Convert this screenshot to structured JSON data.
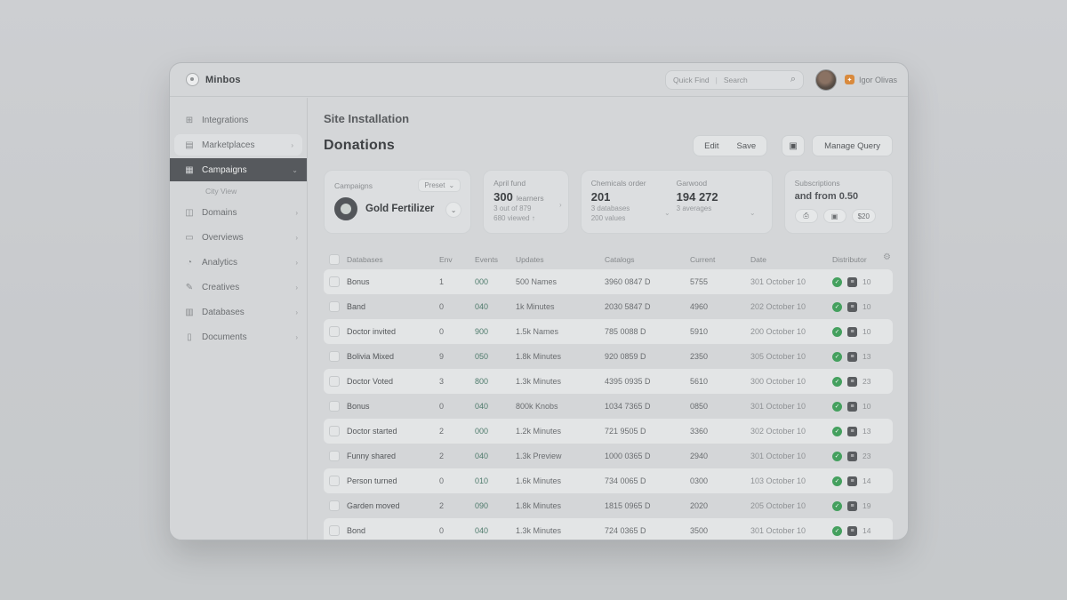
{
  "colors": {
    "accent_green": "#44a05e",
    "teal": "#4f7b6c",
    "orange": "#d98a3d",
    "selected_dark": "#56595d"
  },
  "window": {
    "brand": "Minbos"
  },
  "topbar": {
    "search": {
      "shortcut": "Quick Find",
      "divider": "|",
      "placeholder": "Search",
      "icon": "⌕"
    },
    "user": {
      "name": "Igor Olivas",
      "badge": "✦"
    }
  },
  "sidebar": {
    "items": [
      {
        "label": "Integrations",
        "icon_glyph": "⊞",
        "icon_name": "integrations-icon",
        "chevron": "",
        "variant": "default"
      },
      {
        "label": "Marketplaces",
        "icon_glyph": "▤",
        "icon_name": "marketplaces-icon",
        "chevron": "›",
        "variant": "pill"
      },
      {
        "label": "Campaigns",
        "icon_glyph": "▦",
        "icon_name": "campaigns-icon",
        "chevron": "⌄",
        "variant": "selected"
      },
      {
        "label": "City View",
        "icon_glyph": "",
        "icon_name": "",
        "chevron": "",
        "variant": "sub"
      },
      {
        "label": "Domains",
        "icon_glyph": "◫",
        "icon_name": "domains-icon",
        "chevron": "›",
        "variant": "default"
      },
      {
        "label": "Overviews",
        "icon_glyph": "▭",
        "icon_name": "overviews-icon",
        "chevron": "›",
        "variant": "default"
      },
      {
        "label": "Analytics",
        "icon_glyph": "◔",
        "icon_name": "analytics-icon",
        "chevron": "›",
        "variant": "default"
      },
      {
        "label": "Creatives",
        "icon_glyph": "✎",
        "icon_name": "creatives-icon",
        "chevron": "›",
        "variant": "default"
      },
      {
        "label": "Databases",
        "icon_glyph": "▥",
        "icon_name": "databases-icon",
        "chevron": "›",
        "variant": "default"
      },
      {
        "label": "Documents",
        "icon_glyph": "▯",
        "icon_name": "documents-icon",
        "chevron": "›",
        "variant": "default"
      }
    ]
  },
  "page": {
    "breadcrumb": "Site Installation",
    "title": "Donations"
  },
  "actions": {
    "edit": "Edit",
    "save": "Save",
    "tool_icon": "▣",
    "manage": "Manage Query"
  },
  "cards": {
    "campaigns": {
      "label": "Campaigns",
      "preset": "Preset",
      "preset_chevron": "⌄",
      "donut_label": "Gold Fertilizer",
      "more": "⌄"
    },
    "availability": {
      "label": "April fund",
      "value": "300",
      "unit": "learners",
      "sub1": "3 out of 879",
      "sub2": "680 viewed ↑",
      "chevron": "›"
    },
    "orders": {
      "left": {
        "label": "Chemicals order",
        "value": "201",
        "sub1": "3 databases",
        "sub2": "200 values",
        "chevron": "⌄"
      },
      "right": {
        "label": "Garwood",
        "value": "194 272",
        "sub1": "3 averages",
        "chevron": "⌄"
      }
    },
    "subscriptions": {
      "label": "Subscriptions",
      "text": "and from 0.50",
      "btn1": "⎙",
      "btn2": "▣",
      "btn3": "$20"
    }
  },
  "table": {
    "headers": [
      "Databases",
      "Env",
      "Events",
      "Updates",
      "Catalogs",
      "Current",
      "Date",
      "Distributor"
    ],
    "gear_icon": "⚙",
    "check_glyph": "✓",
    "grid_glyph": "≡",
    "rows": [
      {
        "name": "Bonus",
        "env": "1",
        "events": "000",
        "updates": "500 Names",
        "catalogs": "3960 0847 D",
        "current": "5755",
        "date": "301 October 10",
        "count": "10"
      },
      {
        "name": "Band",
        "env": "0",
        "events": "040",
        "updates": "1k Minutes",
        "catalogs": "2030 5847 D",
        "current": "4960",
        "date": "202 October 10",
        "count": "10"
      },
      {
        "name": "Doctor invited",
        "env": "0",
        "events": "900",
        "updates": "1.5k Names",
        "catalogs": "785 0088 D",
        "current": "5910",
        "date": "200 October 10",
        "count": "10"
      },
      {
        "name": "Bolivia Mixed",
        "env": "9",
        "events": "050",
        "updates": "1.8k Minutes",
        "catalogs": "920 0859 D",
        "current": "2350",
        "date": "305 October 10",
        "count": "13"
      },
      {
        "name": "Doctor Voted",
        "env": "3",
        "events": "800",
        "updates": "1.3k Minutes",
        "catalogs": "4395 0935 D",
        "current": "5610",
        "date": "300 October 10",
        "count": "23"
      },
      {
        "name": "Bonus",
        "env": "0",
        "events": "040",
        "updates": "800k Knobs",
        "catalogs": "1034 7365 D",
        "current": "0850",
        "date": "301 October 10",
        "count": "10"
      },
      {
        "name": "Doctor started",
        "env": "2",
        "events": "000",
        "updates": "1.2k Minutes",
        "catalogs": "721 9505 D",
        "current": "3360",
        "date": "302 October 10",
        "count": "13"
      },
      {
        "name": "Funny shared",
        "env": "2",
        "events": "040",
        "updates": "1.3k Preview",
        "catalogs": "1000 0365 D",
        "current": "2940",
        "date": "301 October 10",
        "count": "23"
      },
      {
        "name": "Person turned",
        "env": "0",
        "events": "010",
        "updates": "1.6k Minutes",
        "catalogs": "734 0065 D",
        "current": "0300",
        "date": "103 October 10",
        "count": "14"
      },
      {
        "name": "Garden moved",
        "env": "2",
        "events": "090",
        "updates": "1.8k Minutes",
        "catalogs": "1815 0965 D",
        "current": "2020",
        "date": "205 October 10",
        "count": "19"
      },
      {
        "name": "Bond",
        "env": "0",
        "events": "040",
        "updates": "1.3k Minutes",
        "catalogs": "724 0365 D",
        "current": "3500",
        "date": "301 October 10",
        "count": "14"
      }
    ]
  }
}
